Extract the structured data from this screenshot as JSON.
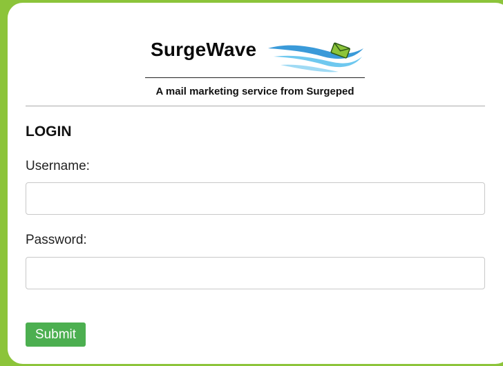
{
  "brand": {
    "name": "SurgeWave",
    "tagline": "A mail marketing service from Surgeped",
    "logo_icon": "envelope-on-wave-icon",
    "colors": {
      "page_background": "#8cc43a",
      "wave_blue": "#3a9ad9",
      "wave_light": "#6ec8ef",
      "envelope_green": "#8cc43a"
    }
  },
  "login_form": {
    "heading": "LOGIN",
    "username_label": "Username:",
    "username_value": "",
    "password_label": "Password:",
    "password_value": "",
    "submit_label": "Submit",
    "submit_color": "#4caf50"
  }
}
